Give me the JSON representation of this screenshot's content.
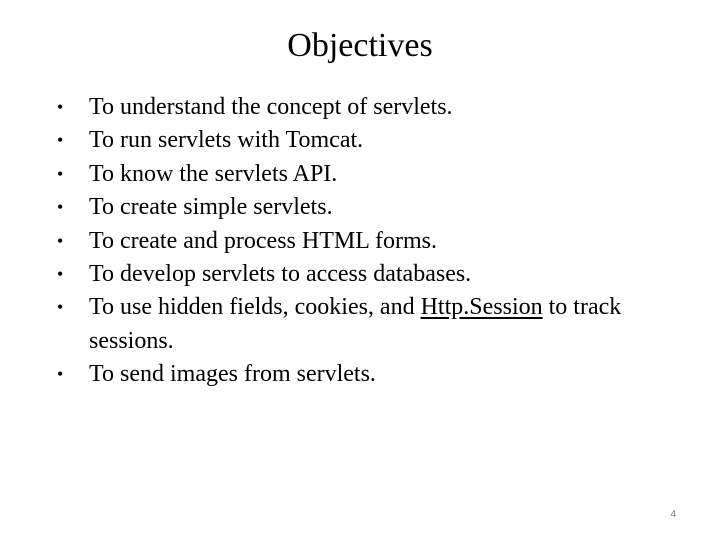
{
  "slide": {
    "title": "Objectives",
    "bullets": [
      {
        "text": "To understand the concept of servlets."
      },
      {
        "text": "To run servlets with Tomcat."
      },
      {
        "text": "To know the servlets API."
      },
      {
        "text": "To create simple servlets."
      },
      {
        "text": "To create and process HTML forms."
      },
      {
        "text": "To develop servlets to access databases."
      },
      {
        "text_before": "To use hidden fields, cookies, and ",
        "link": "Http.Session",
        "text_after": " to track sessions."
      },
      {
        "text": "To send images from servlets."
      }
    ],
    "bullet_glyph": "•",
    "page_number": "4"
  }
}
